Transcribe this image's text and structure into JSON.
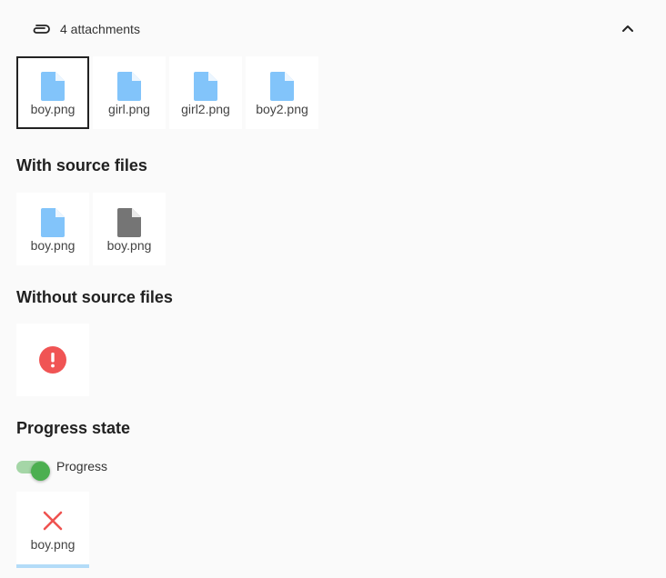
{
  "attachments": {
    "count_label": "4 attachments",
    "files": [
      {
        "name": "boy.png",
        "icon": "file-icon",
        "color": "#82c4fa",
        "selected": true
      },
      {
        "name": "girl.png",
        "icon": "file-icon",
        "color": "#82c4fa",
        "selected": false
      },
      {
        "name": "girl2.png",
        "icon": "file-icon",
        "color": "#82c4fa",
        "selected": false
      },
      {
        "name": "boy2.png",
        "icon": "file-icon",
        "color": "#82c4fa",
        "selected": false
      }
    ]
  },
  "with_source": {
    "title": "With source files",
    "files": [
      {
        "name": "boy.png",
        "icon": "file-icon",
        "color": "#82c4fa"
      },
      {
        "name": "boy.png",
        "icon": "file-icon",
        "color": "#757575"
      }
    ]
  },
  "without_source": {
    "title": "Without source files",
    "error_icon": "error-icon",
    "error_color": "#f05454"
  },
  "progress_state": {
    "title": "Progress state",
    "toggle_label": "Progress",
    "toggle_on": true,
    "file": {
      "name": "boy.png",
      "icon": "close-icon",
      "color": "#ef5350"
    },
    "progress": 1.0,
    "progress_color": "#b3dcf8"
  }
}
